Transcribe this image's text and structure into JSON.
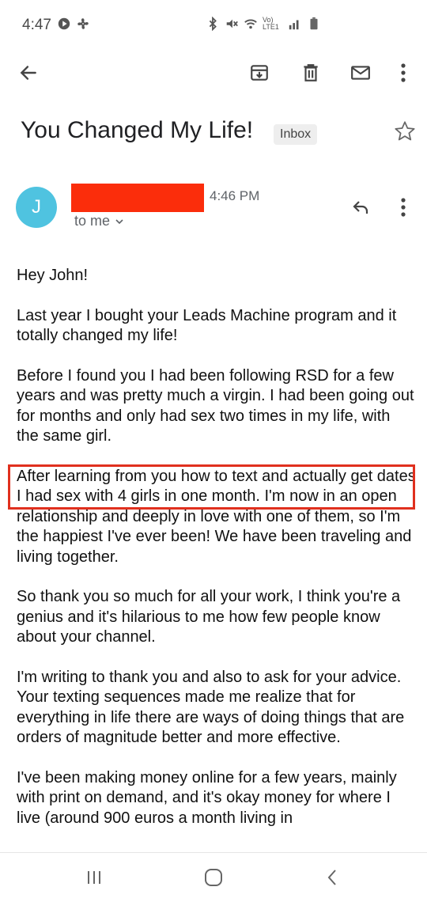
{
  "status_bar": {
    "time": "4:47",
    "icons": [
      "play-circle-icon",
      "fan-icon",
      "bluetooth-icon",
      "mute-icon",
      "wifi-icon",
      "volte-icon",
      "signal-icon",
      "battery-icon"
    ],
    "network_label": "Vo) LTE1"
  },
  "toolbar": {
    "icons": [
      "back-arrow-icon",
      "archive-icon",
      "delete-icon",
      "mark-unread-icon",
      "more-vert-icon"
    ]
  },
  "email": {
    "subject": "You Changed My Life!",
    "label": "Inbox",
    "sender_initial": "J",
    "time": "4:46 PM",
    "recipient": "to me",
    "body": [
      "Hey John!",
      "Last year I bought your Leads Machine program and it totally changed my life!",
      "Before I found you I had been following RSD for a few years and was pretty much a virgin. I had been going out for months and only had sex two times in my life, with the same girl.",
      "After learning from you how to text and actually get dates I had sex with 4 girls in one month. I'm now in an open relationship and deeply in love with one of them, so I'm the happiest I've ever been! We have been traveling and living together.",
      "So thank you so much for all your work, I think you're a genius and it's hilarious to me how few people know about your channel.",
      "I'm writing to thank you and also to ask for your advice. Your texting sequences made me realize that for everything in life there are ways of doing things that are orders of magnitude better and more effective.",
      "I've been making money online for a few years, mainly with print on demand, and it's okay money for where I live (around 900 euros a month living in"
    ]
  },
  "colors": {
    "avatar": "#4fc3e0",
    "redaction": "#fb2d0b",
    "highlight_border": "#e0301e"
  },
  "nav_bar": {
    "icons": [
      "recent-apps-icon",
      "home-icon",
      "back-icon"
    ]
  }
}
